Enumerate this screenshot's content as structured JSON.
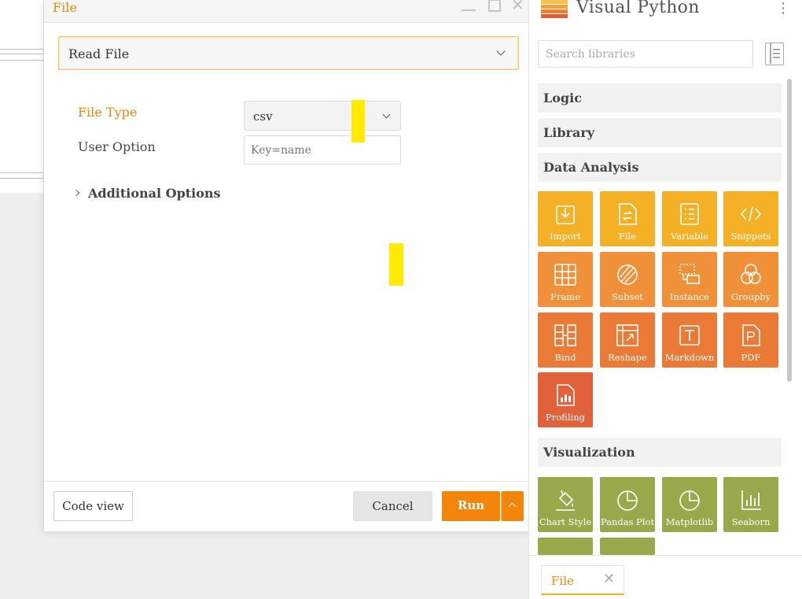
{
  "dialog": {
    "title": "File",
    "function_select": "Read File",
    "file_type_label": "File Type",
    "file_type_value": "csv",
    "user_option_label": "User Option",
    "user_option_placeholder": "Key=name",
    "additional_options_label": "Additional Options",
    "code_view_label": "Code view",
    "cancel_label": "Cancel",
    "run_label": "Run"
  },
  "vp": {
    "title": "Visual Python",
    "search_placeholder": "Search libraries",
    "categories": {
      "logic": "Logic",
      "library": "Library",
      "data_analysis": "Data Analysis",
      "visualization": "Visualization"
    },
    "apps": {
      "import": "Import",
      "file": "File",
      "variable": "Variable",
      "snippets": "Snippets",
      "frame": "Frame",
      "subset": "Subset",
      "instance": "Instance",
      "groupby": "Groupby",
      "bind": "Bind",
      "reshape": "Reshape",
      "markdown": "Markdown",
      "pdf": "PDF",
      "profiling": "Profiling",
      "chart_style": "Chart Style",
      "pandas_plot": "Pandas Plot",
      "matplotlib": "Matplotlib",
      "seaborn": "Seaborn"
    },
    "tab_label": "File"
  },
  "colors": {
    "accent": "#f0870b",
    "data_analysis_yellow": "#f5b126",
    "data_analysis_orange": "#f0913a",
    "data_analysis_deep_orange": "#ea7a36",
    "data_analysis_red": "#e2603a",
    "visualization_green": "#98a94b",
    "highlight_marker": "#ffea00"
  }
}
